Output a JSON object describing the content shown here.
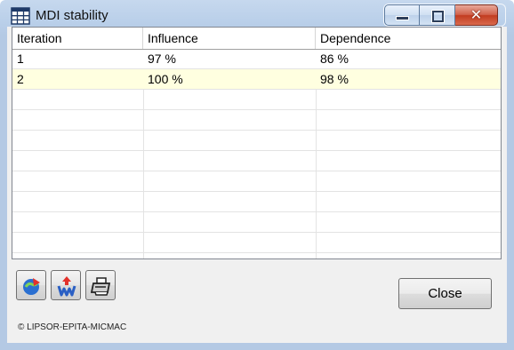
{
  "window": {
    "title": "MDI stability",
    "minimize_label": "",
    "close_glyph": "✕"
  },
  "table": {
    "columns": [
      "Iteration",
      "Influence",
      "Dependence"
    ],
    "rows": [
      [
        "1",
        "97 %",
        "86 %"
      ],
      [
        "2",
        "100 %",
        "98 %"
      ]
    ],
    "selected_row_color": "#ffffe0"
  },
  "toolbar": {
    "icons": [
      "export-icon",
      "weight-icon",
      "print-icon"
    ]
  },
  "buttons": {
    "close_label": "Close"
  },
  "footer": {
    "copyright": "© LIPSOR-EPITA-MICMAC"
  }
}
